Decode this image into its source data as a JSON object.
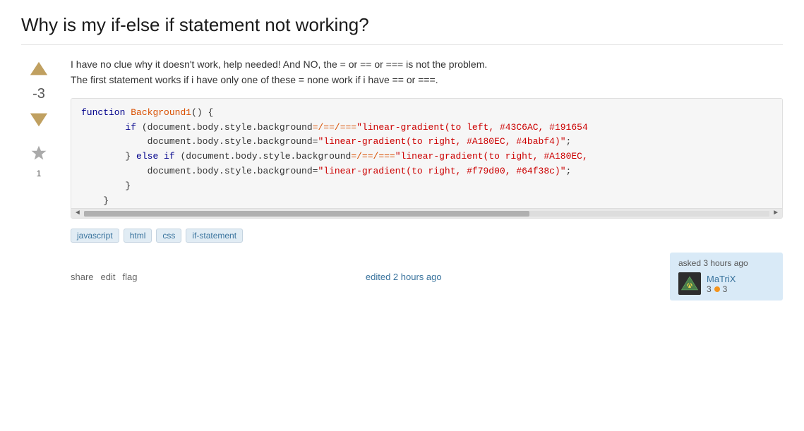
{
  "page": {
    "title": "Why is my if-else if statement not working?"
  },
  "question": {
    "vote_score": "-3",
    "favorite_count": "1",
    "body_line1": "I have no clue why it doesn't work, help needed! And NO, the = or == or === is not the problem.",
    "body_line2": "The first statement works if i have only one of these = none work if i have == or ===.",
    "code": "function Background1() {\n        if (document.body.style.background=/==/===\"linear-gradient(to left, #43C6AC, #191654\n            document.body.style.background=\"linear-gradient(to right, #A180EC, #4babf4)\";\n        } else if (document.body.style.background=/==/===\"linear-gradient(to right, #A180EC,\n            document.body.style.background=\"linear-gradient(to right, #f79d00, #64f38c)\";\n        }\n    }",
    "tags": [
      "javascript",
      "html",
      "css",
      "if-statement"
    ],
    "actions": {
      "share": "share",
      "edit": "edit",
      "flag": "flag"
    },
    "edited_text": "edited 2 hours ago",
    "asked_label": "asked 3 hours ago",
    "user": {
      "name": "MaTriX",
      "rep": "3",
      "badge_count": "3"
    }
  },
  "icons": {
    "vote_up": "▲",
    "vote_down": "▼",
    "star": "★",
    "scroll_left": "◄",
    "scroll_right": "►"
  }
}
